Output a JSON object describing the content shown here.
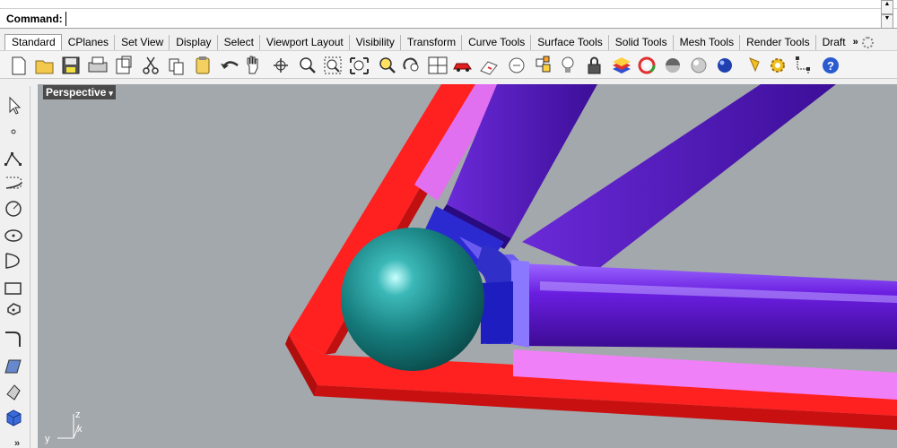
{
  "command": {
    "label": "Command:",
    "value": "",
    "scroll_up": "▲",
    "scroll_down": "▼"
  },
  "tabs": [
    {
      "label": "Standard",
      "active": true
    },
    {
      "label": "CPlanes"
    },
    {
      "label": "Set View"
    },
    {
      "label": "Display"
    },
    {
      "label": "Select"
    },
    {
      "label": "Viewport Layout"
    },
    {
      "label": "Visibility"
    },
    {
      "label": "Transform"
    },
    {
      "label": "Curve Tools"
    },
    {
      "label": "Surface Tools"
    },
    {
      "label": "Solid Tools"
    },
    {
      "label": "Mesh Tools"
    },
    {
      "label": "Render Tools"
    },
    {
      "label": "Draft"
    }
  ],
  "tabs_more": "»",
  "toolbar_icons": [
    "new-icon",
    "open-icon",
    "save-icon",
    "print-icon",
    "import-icon",
    "cut-icon",
    "copy-icon",
    "paste-icon",
    "undo-icon",
    "pan-icon",
    "rotate-view-icon",
    "zoom-dynamic-icon",
    "zoom-window-icon",
    "zoom-extents-icon",
    "zoom-selected-icon",
    "rotate-icon",
    "four-viewports-icon",
    "car-icon",
    "perspective-icon",
    "cplane-icon",
    "osnap-icon",
    "bulb-icon",
    "lock-icon",
    "layer-icon",
    "color-wheel-icon",
    "render-shade-icon",
    "ghost-icon",
    "render-sphere-icon",
    "sun-icon",
    "gear-settings-icon",
    "dimension-icon",
    "help-icon"
  ],
  "left_icons": [
    "select-arrow-icon",
    "point-icon",
    "polyline-icon",
    "curve-icon",
    "circle-icon",
    "ellipse-icon",
    "arc-icon",
    "rectangle-icon",
    "polygon-icon",
    "fillet-icon",
    "surface-icon",
    "extrude-icon",
    "box-icon",
    "more-icon"
  ],
  "viewport": {
    "title": "Perspective",
    "dropdown": "▾",
    "axis_z": "z",
    "axis_y": "y",
    "axis_x": "x"
  },
  "colors": {
    "viewport_bg": "#a3a8ac",
    "frame_red": "#ff2222",
    "tube_purple": "#5a1ab8",
    "tube_magenta": "#e070f0",
    "ball_teal": "#1a8888"
  }
}
